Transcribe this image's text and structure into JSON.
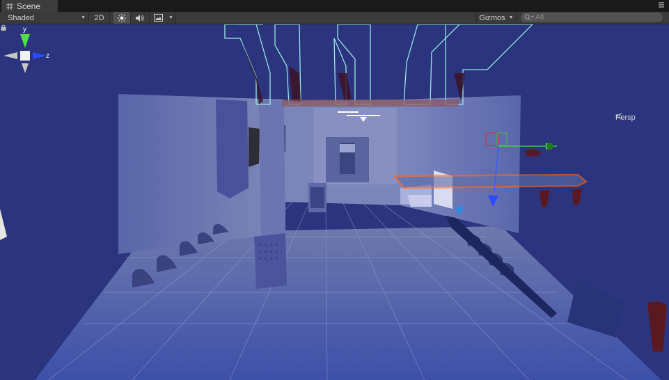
{
  "window": {
    "tab_label": "Scene"
  },
  "toolbar": {
    "shading_mode": "Shaded",
    "mode_2d": "2D",
    "lighting_icon": "sun-icon",
    "audio_icon": "speaker-icon",
    "effects_icon": "image-icon",
    "gizmos_label": "Gizmos",
    "search_placeholder": "All"
  },
  "scene_gizmo": {
    "y_label": "y",
    "z_label": "z",
    "projection_label": "Persp"
  },
  "colors": {
    "viewport_bg": "#2b347c",
    "selection_outline": "#ff6a1a",
    "axis_x": "#d03030",
    "axis_y": "#4fe040",
    "axis_z": "#2a4bff"
  }
}
